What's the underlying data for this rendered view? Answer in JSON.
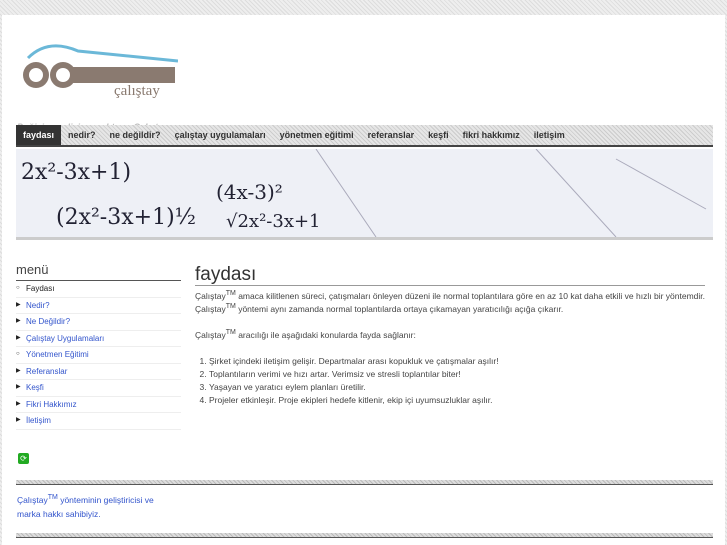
{
  "site": {
    "logo_text": "çalıştay",
    "tagline": "Değişim, gelişim anahtarı : Çalıştay"
  },
  "nav": [
    "faydası",
    "nedir?",
    "ne değildir?",
    "çalıştay uygulamaları",
    "yönetmen eğitimi",
    "referanslar",
    "keşfi",
    "fikri hakkımız",
    "iletişim"
  ],
  "sidebar": {
    "title": "menü",
    "items": [
      "Faydası",
      "Nedir?",
      "Ne Değildir?",
      "Çalıştay Uygulamaları",
      "Yönetmen Eğitimi",
      "Referanslar",
      "Keşfi",
      "Fikri Hakkımız",
      "İletişim"
    ]
  },
  "main": {
    "title": "faydası",
    "tm": "TM",
    "p1a": "Çalıştay",
    "p1b": " amaca kilitlenen süreci, çatışmaları önleyen düzeni ile normal toplantılara göre en az 10 kat daha etkili ve hızlı bir yöntemdir. Çalıştay",
    "p1c": " yöntemi aynı zamanda normal toplantılarda ortaya çıkamayan yaratıcılığı açığa çıkarır.",
    "p2a": "Çalıştay",
    "p2b": " aracılığı ile aşağıdaki konularda fayda sağlanır:",
    "list": [
      "Şirket içindeki iletişim gelişir. Departmalar arası kopukluk ve çatışmalar aşılır!",
      "Toplantıların verimi ve hızı artar. Verimsiz ve stresli toplantılar biter!",
      "Yaşayan ve yaratıcı eylem planları üretilir.",
      "Projeler etkinleşir. Proje ekipleri hedefe kitlenir, ekip içi uyumsuzluklar aşılır."
    ]
  },
  "footer": {
    "a": "Çalıştay",
    "b": " yönteminin geliştiricisi ve marka hakkı sahibiyiz."
  }
}
